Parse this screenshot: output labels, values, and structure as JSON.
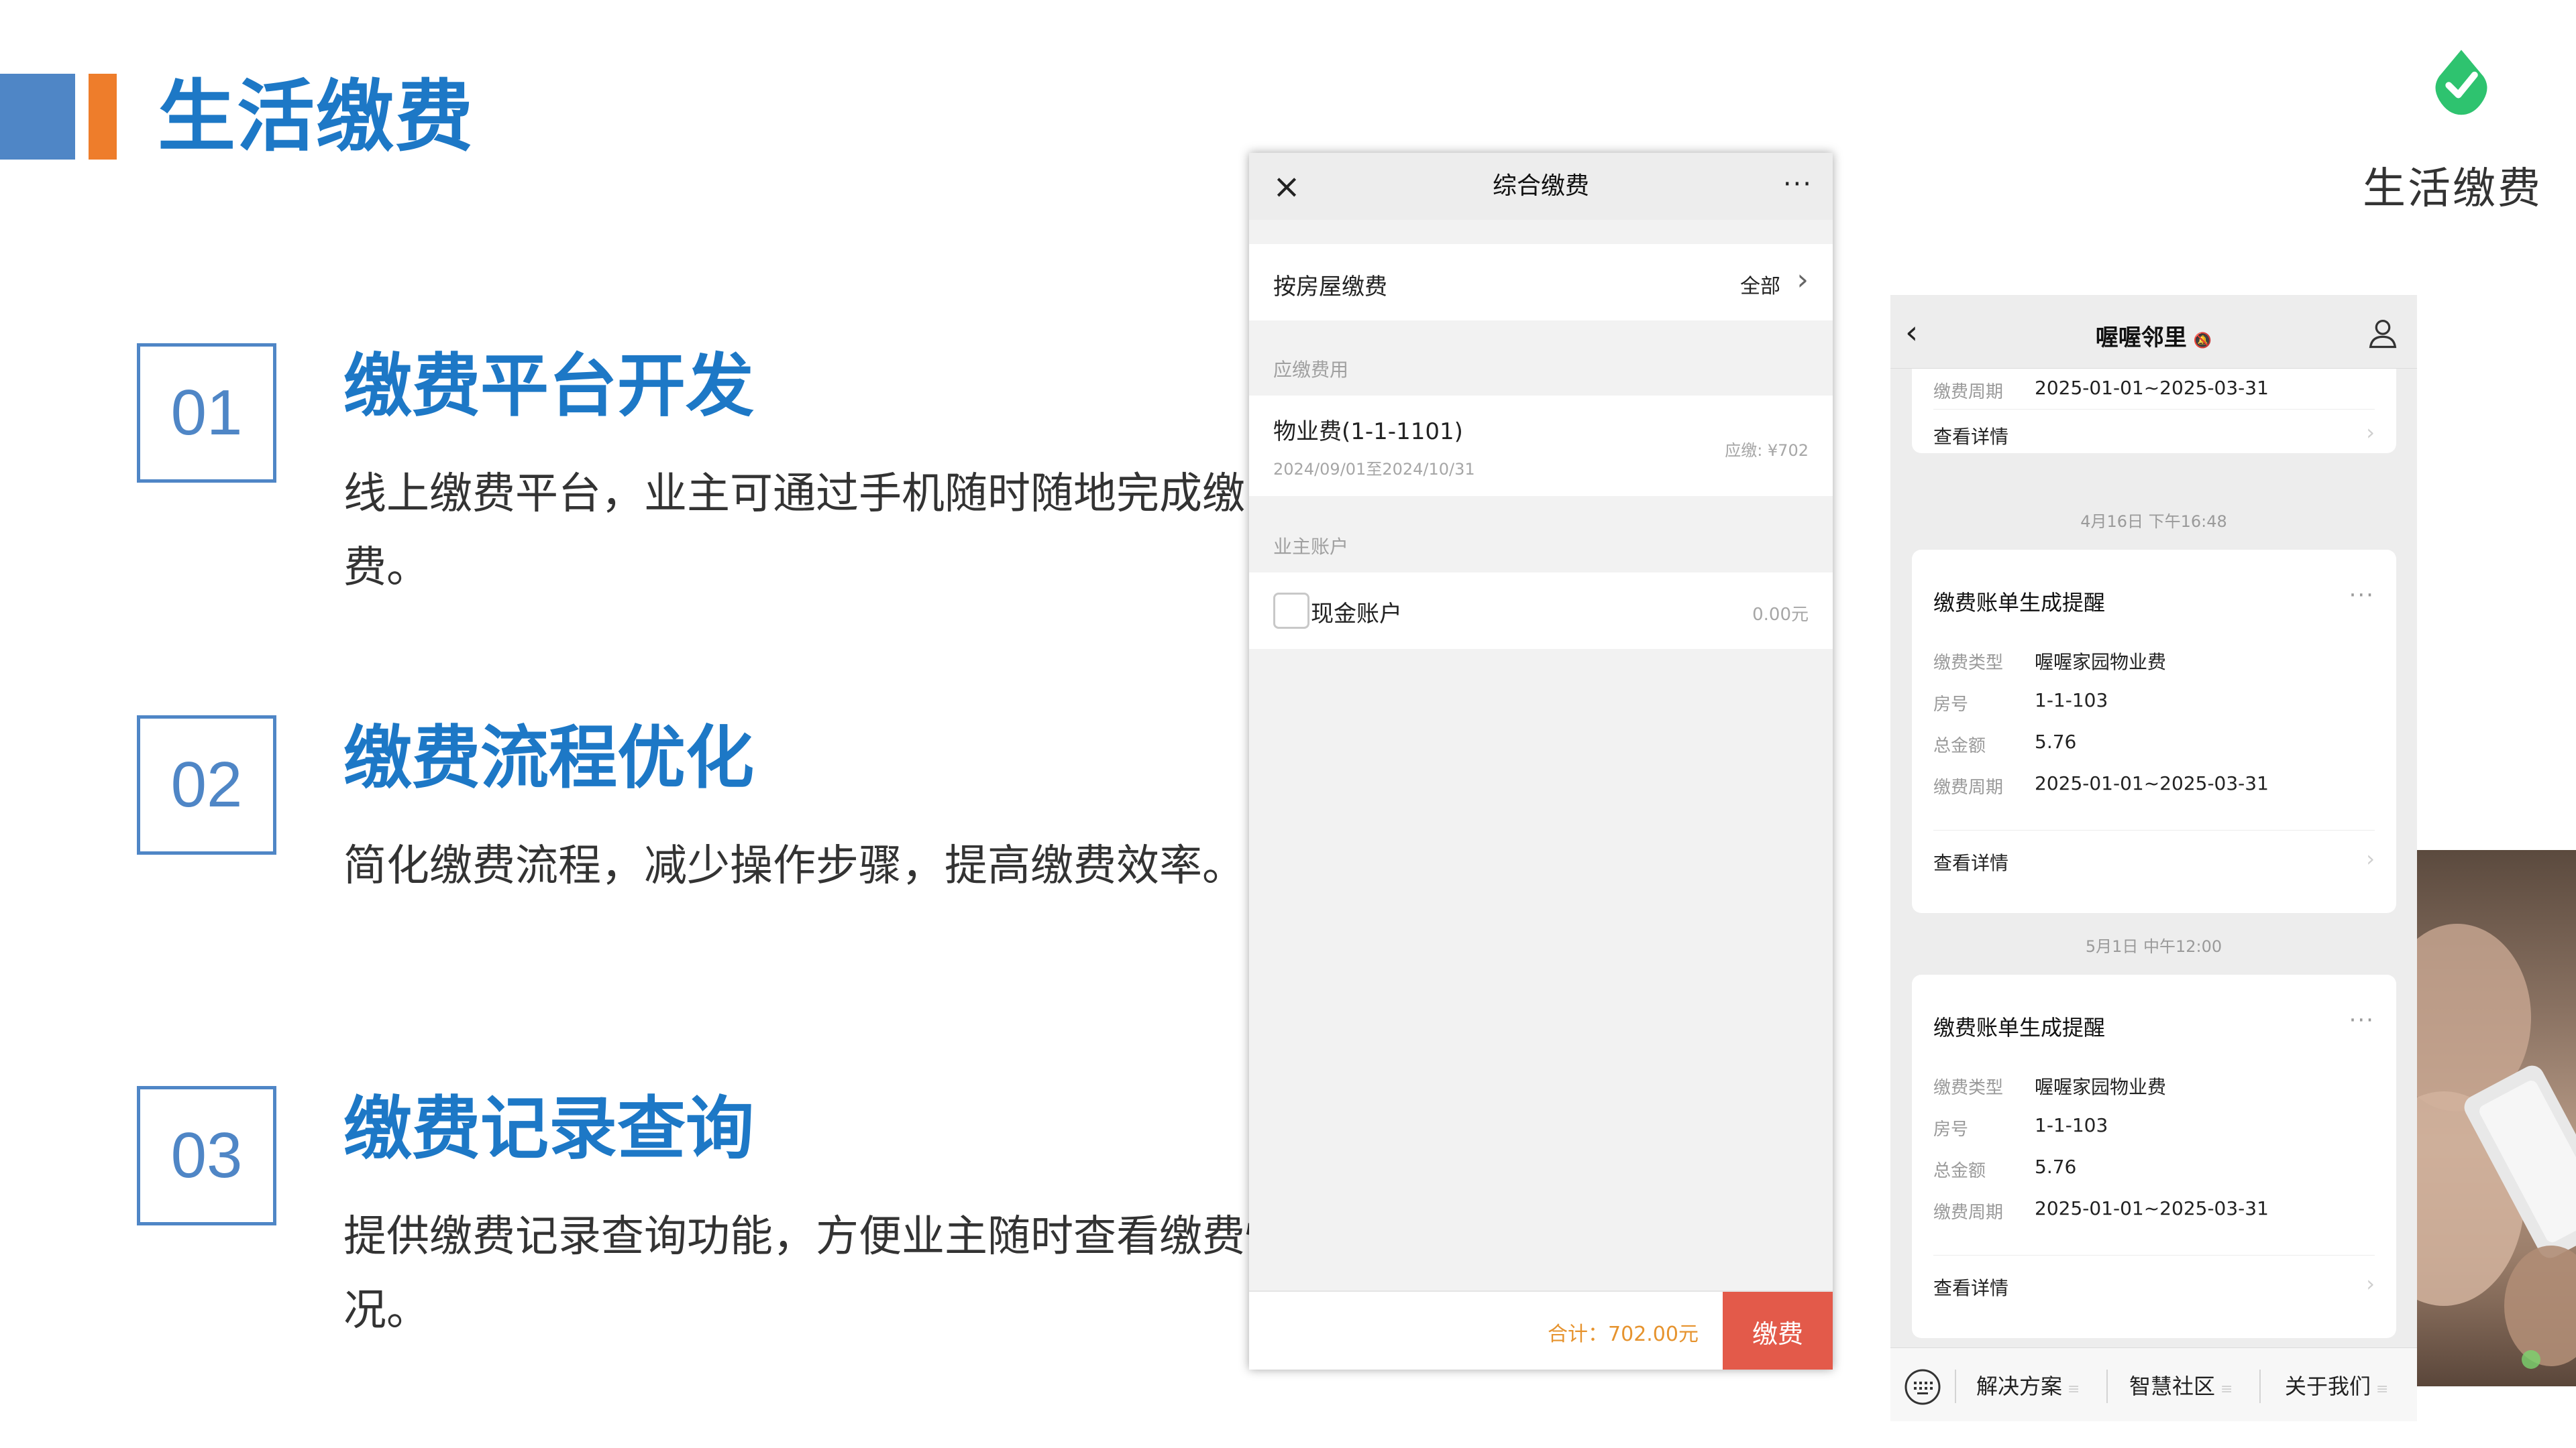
{
  "slide": {
    "title": "生活缴费",
    "brand_text": "生活缴费",
    "colors": {
      "primary_blue": "#1d78c6",
      "box_blue": "#4f86c6",
      "accent_orange": "#ee7d2b",
      "brand_green": "#2ec36f"
    }
  },
  "features": [
    {
      "number": "01",
      "title": "缴费平台开发",
      "desc": "线上缴费平台，业主可通过手机随时随地完成缴费。"
    },
    {
      "number": "02",
      "title": "缴费流程优化",
      "desc": "简化缴费流程，减少操作步骤，提高缴费效率。"
    },
    {
      "number": "03",
      "title": "缴费记录查询",
      "desc": "提供缴费记录查询功能，方便业主随时查看缴费情况。"
    }
  ],
  "phone1": {
    "nav_title": "综合缴费",
    "close_icon": "×",
    "more_icon": "···",
    "house_row": {
      "label": "按房屋缴费",
      "value": "全部",
      "chevron": "›"
    },
    "fees_section": "应缴费用",
    "fee_item": {
      "name": "物业费(1-1-1101)",
      "period": "2024/09/01至2024/10/31",
      "due": "应缴: ¥702"
    },
    "account_section": "业主账户",
    "account_item": {
      "label": "现金账户",
      "value": "0.00元"
    },
    "footer": {
      "total": "合计：702.00元",
      "pay_button": "缴费"
    },
    "colors": {
      "pay_button": "#e35a4a",
      "total_text": "#e6932e"
    }
  },
  "phone2": {
    "nav_title": "喔喔邻里",
    "mute_icon": "🔕",
    "back_icon": "‹",
    "top_partial": {
      "key_text": "缴费周期",
      "value_text": "2025-01-01~2025-03-31",
      "link": "查看详情"
    },
    "timestamps": [
      "4月16日 下午16:48",
      "5月1日 中午12:00"
    ],
    "cards": [
      {
        "title": "缴费账单生成提醒",
        "dots": "···",
        "rows": [
          {
            "key": "缴费类型",
            "value": "喔喔家园物业费"
          },
          {
            "key": "房号",
            "value": "1-1-103"
          },
          {
            "key": "总金额",
            "value": "5.76"
          },
          {
            "key": "缴费周期",
            "value": "2025-01-01~2025-03-31"
          }
        ],
        "link": "查看详情"
      },
      {
        "title": "缴费账单生成提醒",
        "dots": "···",
        "rows": [
          {
            "key": "缴费类型",
            "value": "喔喔家园物业费"
          },
          {
            "key": "房号",
            "value": "1-1-103"
          },
          {
            "key": "总金额",
            "value": "5.76"
          },
          {
            "key": "缴费周期",
            "value": "2025-01-01~2025-03-31"
          }
        ],
        "link": "查看详情"
      }
    ],
    "bottom_menu": [
      "解决方案",
      "智慧社区",
      "关于我们"
    ],
    "menu_dash": "≡"
  }
}
